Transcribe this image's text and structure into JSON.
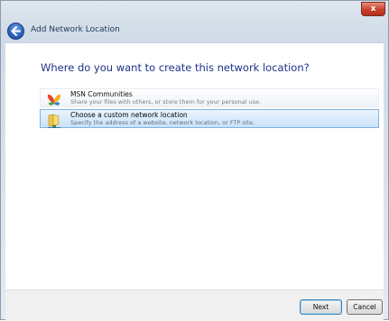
{
  "window": {
    "title": "Add Network Location",
    "close_label": "x"
  },
  "main": {
    "question": "Where do you want to create this network location?",
    "options": [
      {
        "title": "MSN Communities",
        "description": "Share your files with others, or store them for your personal use.",
        "icon": "msn-butterfly-icon",
        "selected": false
      },
      {
        "title": "Choose a custom network location",
        "description": "Specify the address of a website, network location, or FTP site.",
        "icon": "network-folder-icon",
        "selected": true
      }
    ]
  },
  "footer": {
    "next_label": "Next",
    "cancel_label": "Cancel"
  },
  "colors": {
    "question_text": "#1e3287",
    "selection_border": "#7fb4e2"
  }
}
